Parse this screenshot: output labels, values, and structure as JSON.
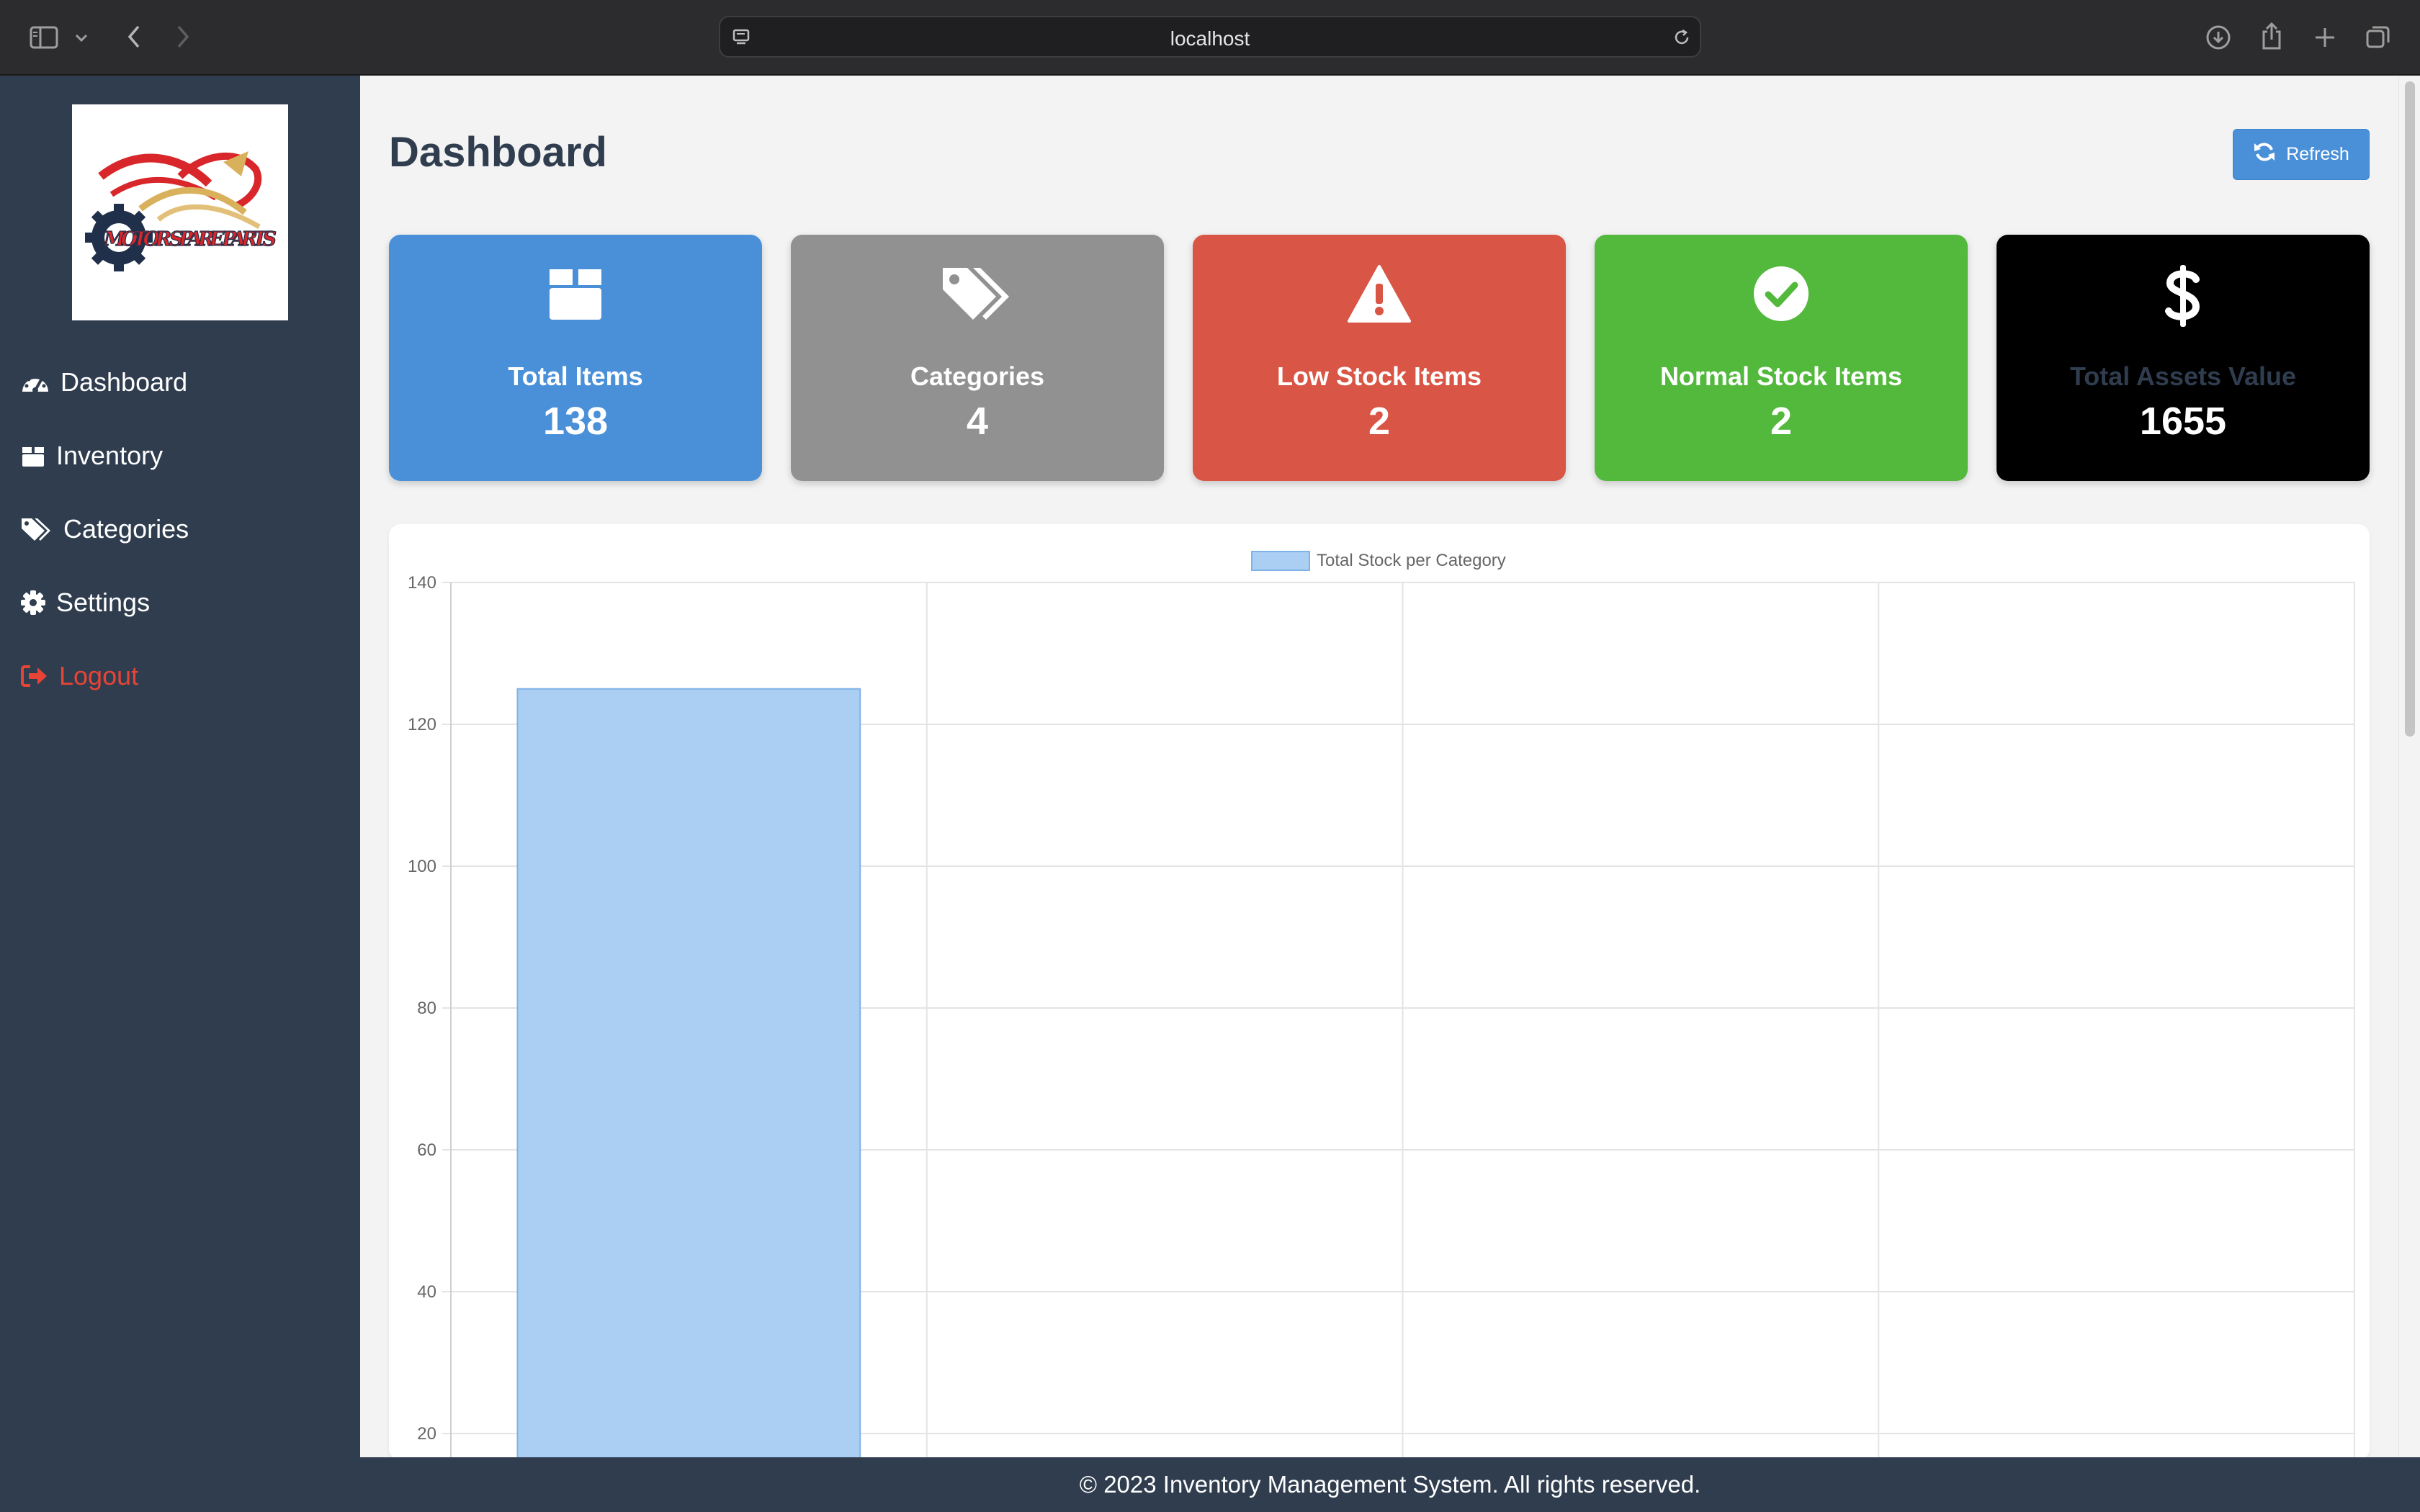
{
  "browser": {
    "url": "localhost"
  },
  "sidebar": {
    "logo_text": "MOTOR SPARE PARTS",
    "items": [
      {
        "label": "Dashboard",
        "icon": "tachometer-icon"
      },
      {
        "label": "Inventory",
        "icon": "box-icon"
      },
      {
        "label": "Categories",
        "icon": "tags-icon"
      },
      {
        "label": "Settings",
        "icon": "gear-icon"
      },
      {
        "label": "Logout",
        "icon": "sign-out-icon"
      }
    ]
  },
  "header": {
    "title": "Dashboard",
    "refresh_label": "Refresh"
  },
  "cards": [
    {
      "label": "Total Items",
      "value": "138",
      "color": "#4a90d9",
      "icon": "box-icon"
    },
    {
      "label": "Categories",
      "value": "4",
      "color": "#919191",
      "icon": "tags-icon"
    },
    {
      "label": "Low Stock Items",
      "value": "2",
      "color": "#d95545",
      "icon": "warning-icon"
    },
    {
      "label": "Normal Stock Items",
      "value": "2",
      "color": "#52b93c",
      "icon": "check-circle-icon"
    },
    {
      "label": "Total Assets Value",
      "value": "1655",
      "color": "#000000",
      "label_color": "#2f3d4f",
      "icon": "dollar-icon"
    }
  ],
  "chart_data": {
    "type": "bar",
    "series": [
      {
        "name": "Total Stock per Category",
        "values": [
          125,
          null,
          null,
          null
        ],
        "color": "#abcff3"
      }
    ],
    "categories": [
      "",
      "",
      "",
      ""
    ],
    "ylim": [
      0,
      140
    ],
    "yticks": [
      20,
      40,
      60,
      80,
      100,
      120,
      140
    ],
    "grid": true,
    "legend": "top-center"
  },
  "footer": {
    "text": "© 2023 Inventory Management System. All rights reserved."
  }
}
